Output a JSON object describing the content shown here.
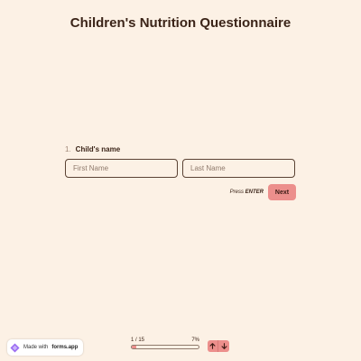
{
  "form": {
    "title": "Children's Nutrition Questionnaire"
  },
  "question": {
    "number": "1.",
    "label": "Child's name",
    "first_name_placeholder": "First Name",
    "last_name_placeholder": "Last Name",
    "first_name_value": "",
    "last_name_value": ""
  },
  "actions": {
    "hint_prefix": "Press",
    "hint_key": "ENTER",
    "next_label": "Next"
  },
  "progress": {
    "counter": "1 / 15",
    "percent_label": "7%",
    "fraction": 0.07
  },
  "badge": {
    "made_with": "Made with",
    "brand": "forms.app"
  },
  "colors": {
    "background": "#fcf1e5",
    "accent": "#ec8f8c",
    "text": "#3b2418"
  },
  "icons": {
    "up": "arrow-up-icon",
    "down": "arrow-down-icon",
    "logo": "forms-app-logo-icon"
  }
}
